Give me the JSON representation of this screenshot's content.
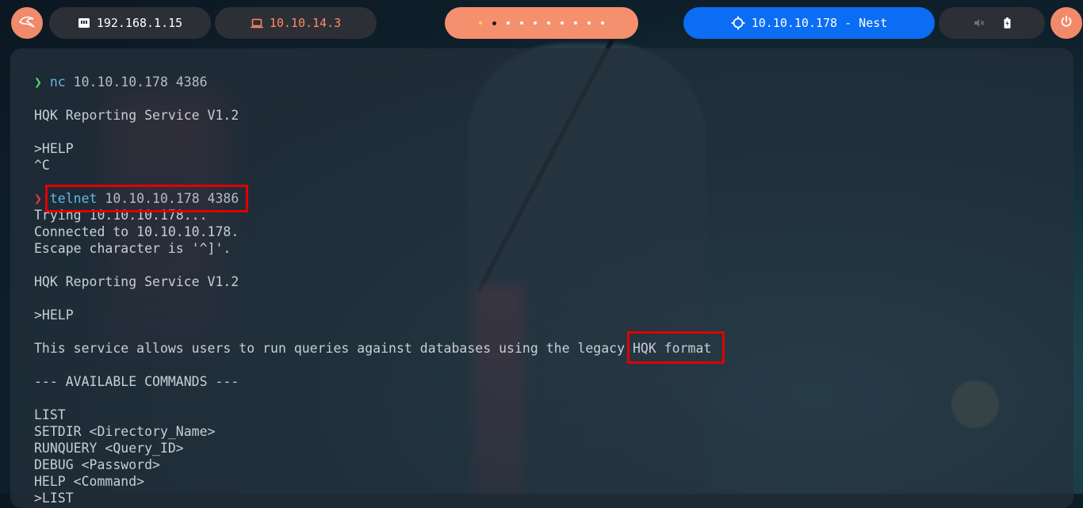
{
  "topbar": {
    "launcher_icon": "kali-dragon-icon",
    "local_ip": "192.168.1.15",
    "local_icon": "ethernet-icon",
    "vpn_ip": "10.10.14.3",
    "vpn_icon": "laptop-icon",
    "workspaces": {
      "count": 10,
      "active_index": 1
    },
    "target_label": "10.10.10.178 - Nest",
    "target_icon": "crosshair-icon",
    "status_icons": [
      "volume-muted-icon",
      "battery-icon"
    ],
    "power_icon": "power-icon"
  },
  "colors": {
    "accent": "#f5906e",
    "target_bg": "#0a6df4",
    "highlight_box": "#e00000",
    "prompt_ok": "#4cd964",
    "prompt_err": "#e8393a",
    "command": "#5fb6e8"
  },
  "terminal": {
    "cmd1": {
      "prompt": "❯",
      "command": "nc",
      "args": " 10.10.10.178 4386"
    },
    "lines_a": [
      "",
      "HQK Reporting Service V1.2",
      "",
      ">HELP",
      "^C",
      ""
    ],
    "cmd2": {
      "prompt": "❯",
      "command": "telnet",
      "args": " 10.10.10.178 4386"
    },
    "lines_b": [
      "Trying 10.10.10.178...",
      "Connected to 10.10.10.178.",
      "Escape character is '^]'.",
      "",
      "HQK Reporting Service V1.2",
      "",
      ">HELP",
      ""
    ],
    "help_prefix": "This service allows users to run queries against databases using the legacy ",
    "help_highlight": "HQK format",
    "lines_c": [
      "",
      "--- AVAILABLE COMMANDS ---",
      "",
      "LIST",
      "SETDIR <Directory_Name>",
      "RUNQUERY <Query_ID>",
      "DEBUG <Password>",
      "HELP <Command>",
      ">LIST"
    ]
  }
}
